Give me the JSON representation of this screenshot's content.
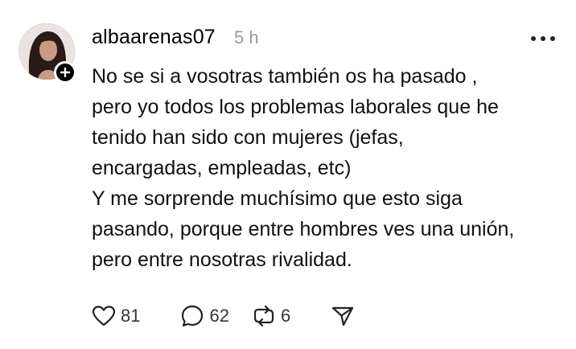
{
  "post": {
    "username": "albaarenas07",
    "time": "5 h",
    "lines": [
      "No se si a vosotras también os ha pasado ,",
      "pero yo todos los problemas laborales que he",
      "tenido han sido con mujeres (jefas,",
      "encargadas, empleadas, etc)",
      "Y me sorprende muchísimo que esto siga",
      "pasando, porque entre hombres ves una unión,",
      "pero entre nosotras rivalidad."
    ]
  },
  "actions": {
    "likes": "81",
    "comments": "62",
    "reposts": "6"
  },
  "icons": {
    "like": "heart-icon",
    "comment": "comment-bubble-icon",
    "repost": "repost-icon",
    "share": "send-icon",
    "menu": "more-dots-icon",
    "follow": "plus-icon"
  }
}
